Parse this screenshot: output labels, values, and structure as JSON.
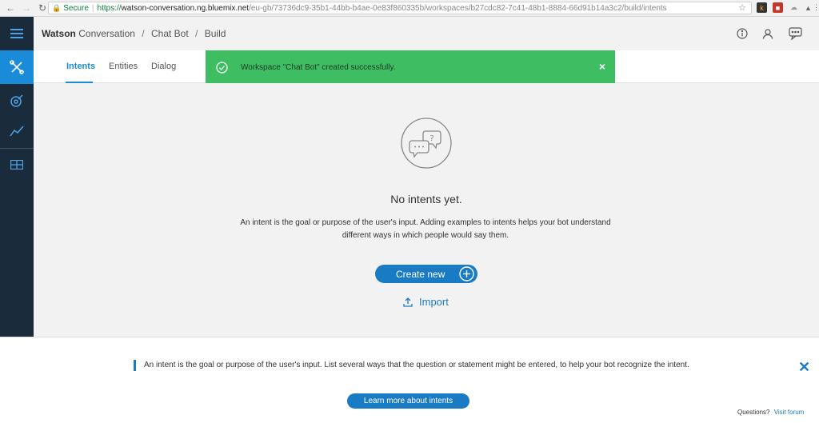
{
  "browser": {
    "secure_label": "Secure",
    "url_scheme": "https://",
    "url_host": "watson-conversation.ng.bluemix.net",
    "url_path": "/eu-gb/73736dc9-35b1-44bb-b4ae-0e83f860335b/workspaces/b27cdc82-7c41-48b1-8884-66d91b14a3c2/build/intents"
  },
  "header": {
    "brand": "Watson",
    "product": "Conversation",
    "crumb_workspace": "Chat Bot",
    "crumb_page": "Build"
  },
  "tabs": [
    {
      "label": "Intents"
    },
    {
      "label": "Entities"
    },
    {
      "label": "Dialog"
    }
  ],
  "toast": {
    "message": "Workspace \"Chat Bot\" created successfully.",
    "close": "×"
  },
  "empty_state": {
    "title": "No intents yet.",
    "description": "An intent is the goal or purpose of the user's input. Adding examples to intents helps your bot understand different ways in which people would say them.",
    "create_label": "Create new",
    "import_label": "Import"
  },
  "info_panel": {
    "text": "An intent is the goal or purpose of the user's input. List several ways that the question or statement might be entered, to help your bot recognize the intent.",
    "learn_label": "Learn more about intents",
    "questions_label": "Questions?",
    "forum_label": "Visit forum",
    "close": "✕"
  },
  "colors": {
    "accent": "#1a7bc5",
    "rail": "#1a2b3c",
    "toast": "#3ebd63"
  }
}
